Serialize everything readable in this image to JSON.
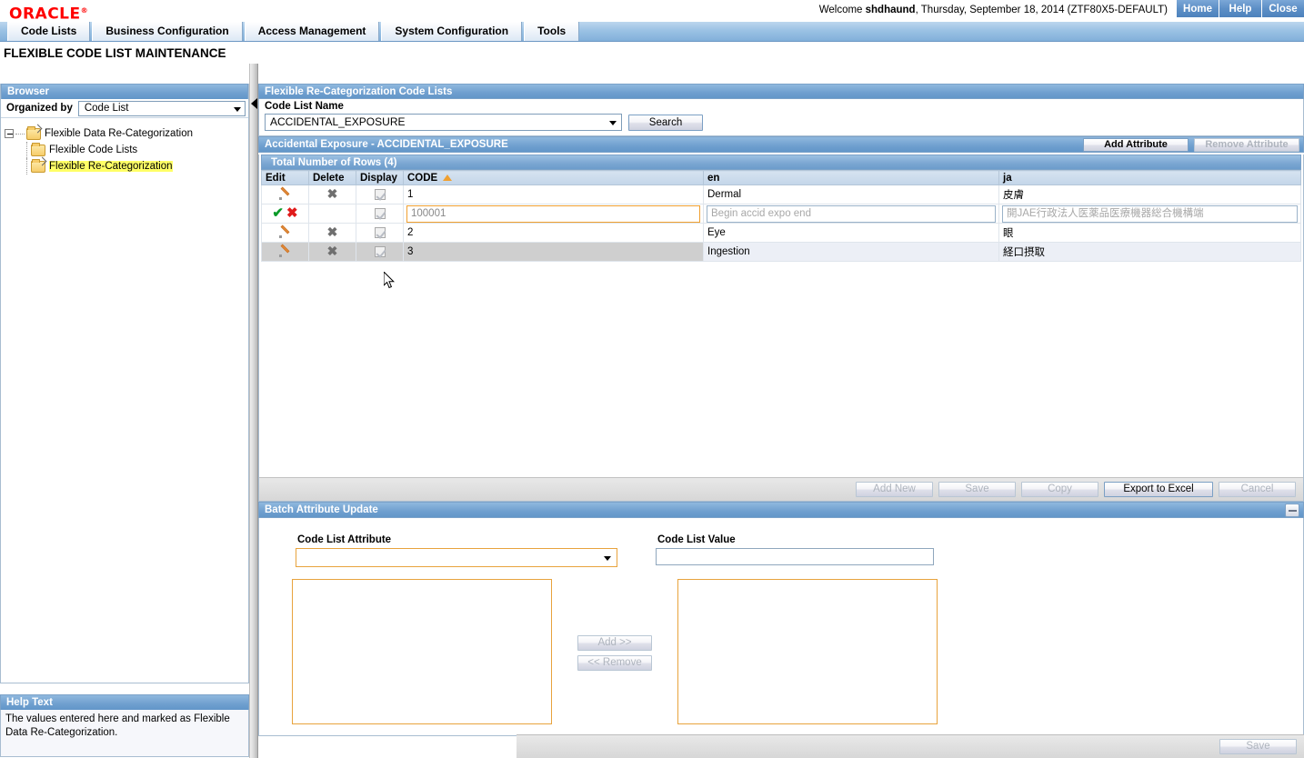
{
  "brand": {
    "name": "ORACLE",
    "registered": "®"
  },
  "topbar": {
    "welcome_prefix": "Welcome ",
    "user": "shdhaund",
    "welcome_suffix": ", Thursday, September 18, 2014 (ZTF80X5-DEFAULT)",
    "links": [
      {
        "label": "Home",
        "name": "home-link"
      },
      {
        "label": "Help",
        "name": "help-link"
      },
      {
        "label": "Close",
        "name": "close-link"
      }
    ]
  },
  "menu": {
    "tabs": [
      {
        "label": "Code Lists"
      },
      {
        "label": "Business Configuration"
      },
      {
        "label": "Access Management"
      },
      {
        "label": "System Configuration"
      },
      {
        "label": "Tools"
      }
    ]
  },
  "page": {
    "title": "FLEXIBLE CODE LIST MAINTENANCE"
  },
  "browser": {
    "header": "Browser",
    "organized_by_label": "Organized by",
    "organized_by_value": "Code List",
    "tree": [
      {
        "label": "Flexible Data Re-Categorization",
        "level": 0,
        "highlighted": false,
        "open": true
      },
      {
        "label": "Flexible Code Lists",
        "level": 1,
        "highlighted": false,
        "open": false
      },
      {
        "label": "Flexible Re-Categorization",
        "level": 1,
        "highlighted": true,
        "open": true
      }
    ]
  },
  "help": {
    "header": "Help Text",
    "text": "The values entered here and marked as Flexible Data Re-Categorization."
  },
  "codelists": {
    "header": "Flexible Re-Categorization Code Lists",
    "code_list_name_label": "Code List Name",
    "code_list_name_value": "ACCIDENTAL_EXPOSURE",
    "search_button": "Search"
  },
  "detail": {
    "header": "Accidental Exposure - ACCIDENTAL_EXPOSURE",
    "add_attribute_button": "Add Attribute",
    "remove_attribute_button": "Remove Attribute",
    "rows_header": "Total Number of Rows (4)",
    "columns": [
      {
        "label": "Edit"
      },
      {
        "label": "Delete"
      },
      {
        "label": "Display"
      },
      {
        "label": "CODE",
        "sort": "asc"
      },
      {
        "label": "en"
      },
      {
        "label": "ja"
      }
    ],
    "rows": [
      {
        "mode": "view",
        "code": "1",
        "en": "Dermal",
        "ja": "皮膚",
        "stripe": "even"
      },
      {
        "mode": "edit",
        "code": "100001",
        "en_placeholder": "Begin accid expo end",
        "ja_placeholder": "開JAE行政法人医薬品医療機器総合機構端",
        "stripe": "edit"
      },
      {
        "mode": "view",
        "code": "2",
        "en": "Eye",
        "ja": "眼",
        "stripe": "even"
      },
      {
        "mode": "view",
        "code": "3",
        "en": "Ingestion",
        "ja": "経口摂取",
        "stripe": "odd"
      }
    ],
    "buttons": [
      {
        "label": "Add New",
        "enabled": false
      },
      {
        "label": "Save",
        "enabled": false
      },
      {
        "label": "Copy",
        "enabled": false
      },
      {
        "label": "Export to Excel",
        "enabled": true
      },
      {
        "label": "Cancel",
        "enabled": false
      }
    ]
  },
  "batch": {
    "header": "Batch Attribute Update",
    "attribute_label": "Code List Attribute",
    "attribute_value": "",
    "value_label": "Code List Value",
    "value_value": "",
    "add_button": "Add >>",
    "remove_button": "<< Remove",
    "save_button": "Save"
  }
}
